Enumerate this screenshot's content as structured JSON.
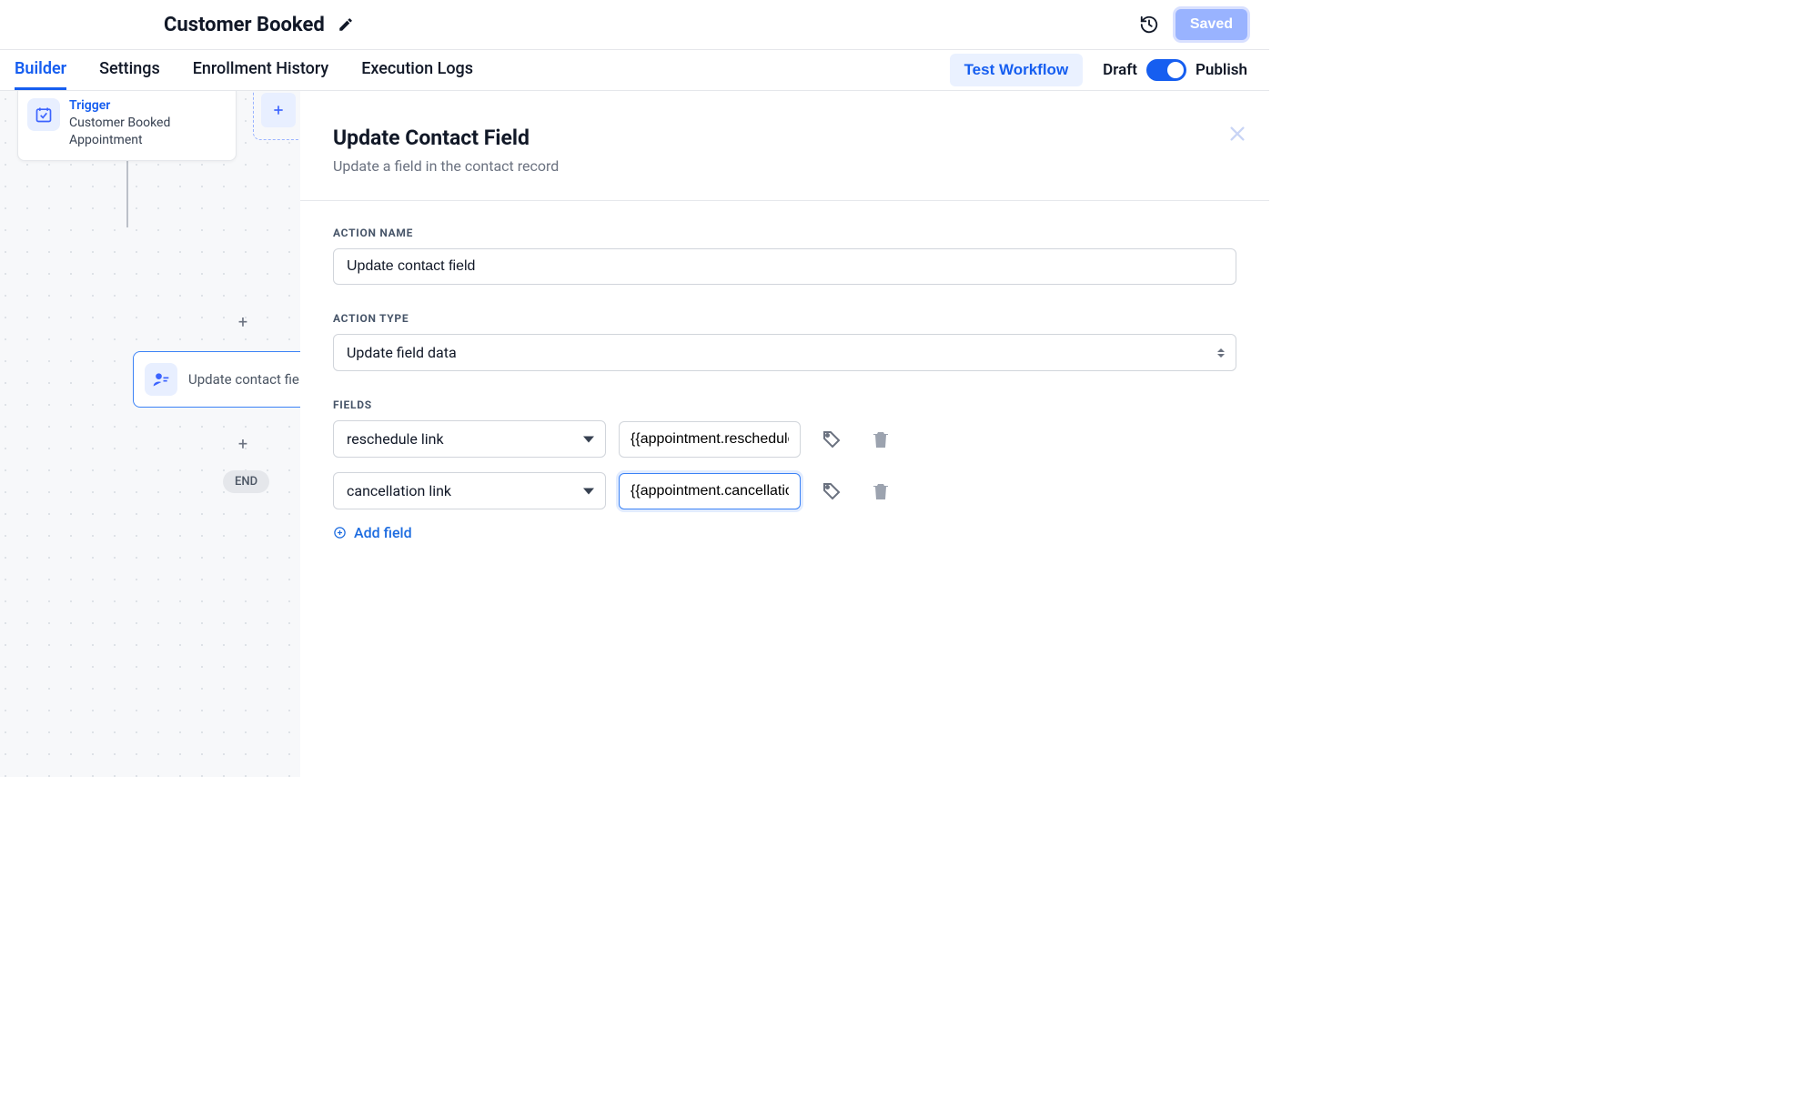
{
  "header": {
    "title": "Customer Booked",
    "saved_label": "Saved"
  },
  "tabs": {
    "items": [
      "Builder",
      "Settings",
      "Enrollment History",
      "Execution Logs"
    ],
    "active_index": 0,
    "test_label": "Test Workflow",
    "draft_label": "Draft",
    "publish_label": "Publish",
    "publish_on": true
  },
  "canvas": {
    "trigger": {
      "badge": "Trigger",
      "title": "Customer Booked Appointment"
    },
    "action_node_label": "Update contact field",
    "end_label": "END"
  },
  "panel": {
    "title": "Update Contact Field",
    "subtitle": "Update a field in the contact record",
    "labels": {
      "action_name": "ACTION NAME",
      "action_type": "ACTION TYPE",
      "fields": "FIELDS"
    },
    "action_name_value": "Update contact field",
    "action_type_value": "Update field data",
    "fields": [
      {
        "name": "reschedule link",
        "value": "{{appointment.reschedule_l",
        "focused": false
      },
      {
        "name": "cancellation link",
        "value": "{{appointment.cancellation_",
        "focused": true
      }
    ],
    "add_field_label": "Add field"
  }
}
